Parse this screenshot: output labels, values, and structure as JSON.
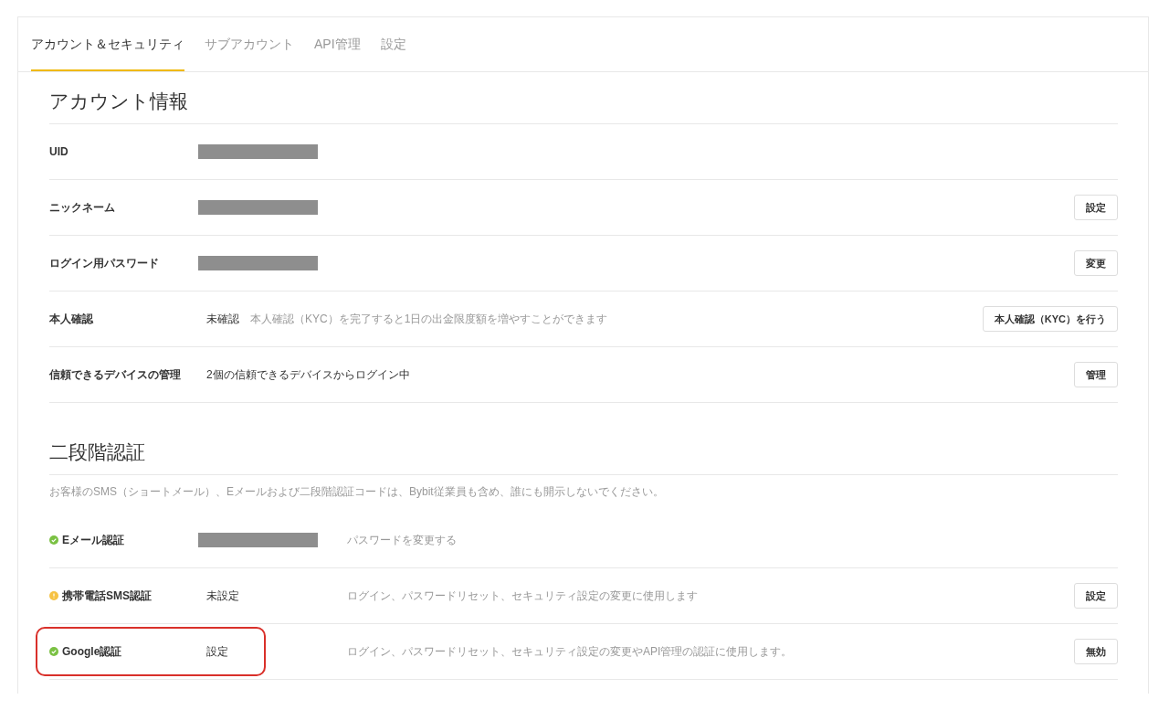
{
  "tabs": [
    {
      "label": "アカウント＆セキュリティ",
      "selected": true
    },
    {
      "label": "サブアカウント",
      "selected": false
    },
    {
      "label": "API管理",
      "selected": false
    },
    {
      "label": "設定",
      "selected": false
    }
  ],
  "account_info": {
    "title": "アカウント情報",
    "rows": [
      {
        "label": "UID",
        "redacted": true
      },
      {
        "label": "ニックネーム",
        "redacted": true,
        "button": "設定"
      },
      {
        "label": "ログイン用パスワード",
        "redacted": true,
        "button": "変更"
      },
      {
        "label": "本人確認",
        "value": "未確認",
        "note": "本人確認（KYC）を完了すると1日の出金限度額を増やすことができます",
        "button": "本人確認（KYC）を行う"
      },
      {
        "label": "信頼できるデバイスの管理",
        "value": "2個の信頼できるデバイスからログイン中",
        "button": "管理"
      }
    ]
  },
  "two_factor": {
    "title": "二段階認証",
    "notice": "お客様のSMS（ショートメール）、Eメールおよび二段階認証コードは、Bybit従業員も含め、誰にも開示しないでください。",
    "rows": [
      {
        "label": "Eメール認証",
        "warning": false,
        "color": "#7ac143",
        "redacted": true,
        "description": "パスワードを変更する",
        "highlighted": false
      },
      {
        "label": "携帯電話SMS認証",
        "warning": true,
        "color": "#f6c244",
        "value": "未設定",
        "description": "ログイン、パスワードリセット、セキュリティ設定の変更に使用します",
        "button": "設定",
        "highlighted": false
      },
      {
        "label": "Google認証",
        "warning": false,
        "color": "#7ac143",
        "value": "設定",
        "description": "ログイン、パスワードリセット、セキュリティ設定の変更やAPI管理の認証に使用します。",
        "button": "無効",
        "highlighted": true
      }
    ]
  }
}
